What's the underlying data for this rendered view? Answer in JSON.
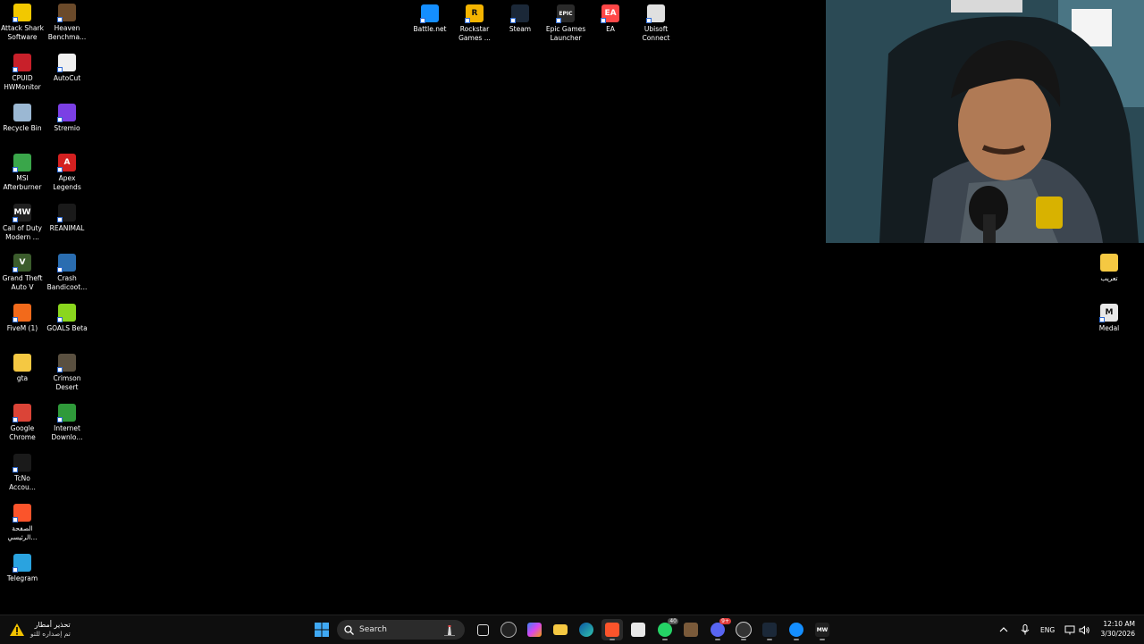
{
  "desktop": {
    "left_col1": [
      {
        "label": "Attack Shark\nSoftware",
        "icon": "shark-icon",
        "color": "#f2c800"
      },
      {
        "label": "CPUID\nHWMonitor",
        "icon": "hwmonitor-icon",
        "color": "#c8202a"
      },
      {
        "label": "Recycle Bin",
        "icon": "recycle-bin-icon",
        "color": "#9bb8d3"
      },
      {
        "label": "MSI\nAfterburner",
        "icon": "afterburner-icon",
        "color": "#3aa64a"
      },
      {
        "label": "Call of Duty\nModern ...",
        "icon": "mw-icon",
        "color": "#202020",
        "glyph": "MW"
      },
      {
        "label": "Grand Theft\nAuto V",
        "icon": "gta-icon",
        "color": "#3b5c2c",
        "glyph": "V"
      },
      {
        "label": "FiveM (1)",
        "icon": "fivem-icon",
        "color": "#f26a1b"
      },
      {
        "label": "gta",
        "icon": "folder-icon",
        "color": "#f5c842"
      },
      {
        "label": "Google\nChrome",
        "icon": "chrome-icon",
        "color": "#db4437"
      },
      {
        "label": "TcNo\nAccou...",
        "icon": "tcno-icon",
        "color": "#1a1a1a"
      },
      {
        "label": "الصفحة\nالرئيسي...",
        "icon": "brave-icon",
        "color": "#fb542b"
      },
      {
        "label": "Telegram",
        "icon": "telegram-icon",
        "color": "#2aa3df"
      }
    ],
    "left_col2": [
      {
        "label": "Heaven\nBenchma...",
        "icon": "heaven-icon",
        "color": "#6b4a2a"
      },
      {
        "label": "AutoCut",
        "icon": "autocut-icon",
        "color": "#f0f0f0"
      },
      {
        "label": "Stremio",
        "icon": "stremio-icon",
        "color": "#7b3fe4"
      },
      {
        "label": "Apex\nLegends",
        "icon": "apex-icon",
        "color": "#d42020",
        "glyph": "A"
      },
      {
        "label": "REANIMAL",
        "icon": "reanimal-icon",
        "color": "#1a1a1a"
      },
      {
        "label": "Crash\nBandicoot...",
        "icon": "crash-icon",
        "color": "#2a6db0"
      },
      {
        "label": "GOALS Beta",
        "icon": "goals-icon",
        "color": "#8ad61e"
      },
      {
        "label": "Crimson\nDesert",
        "icon": "crimson-desert-icon",
        "color": "#5a5040"
      },
      {
        "label": "Internet\nDownlo...",
        "icon": "idm-icon",
        "color": "#2f9a3a"
      }
    ],
    "top_row": [
      {
        "label": "Battle.net",
        "icon": "battlenet-icon",
        "color": "#148eff"
      },
      {
        "label": "Rockstar\nGames ...",
        "icon": "rockstar-icon",
        "color": "#f4b400",
        "glyph": "R"
      },
      {
        "label": "Steam",
        "icon": "steam-icon",
        "color": "#1b2838"
      },
      {
        "label": "Epic Games\nLauncher",
        "icon": "epic-icon",
        "color": "#2a2a2a",
        "glyph": "EPIC"
      },
      {
        "label": "EA",
        "icon": "ea-icon",
        "color": "#ff4747",
        "glyph": "EA"
      },
      {
        "label": "Ubisoft\nConnect",
        "icon": "ubisoft-icon",
        "color": "#e0e0e0"
      }
    ],
    "right_col": [
      {
        "label": "تعريب",
        "icon": "folder-icon",
        "color": "#f5c842"
      },
      {
        "label": "Medal",
        "icon": "medal-icon",
        "color": "#e8e8e8",
        "glyph": "M"
      }
    ]
  },
  "taskbar": {
    "weather_title": "تحذير أمطار",
    "weather_subtitle": "تم إصداره للتو",
    "search_label": "Search",
    "discord_badge": "9+",
    "whatsapp_badge": "40",
    "language": "ENG",
    "time": "12:10 AM",
    "date": "3/30/2026"
  }
}
